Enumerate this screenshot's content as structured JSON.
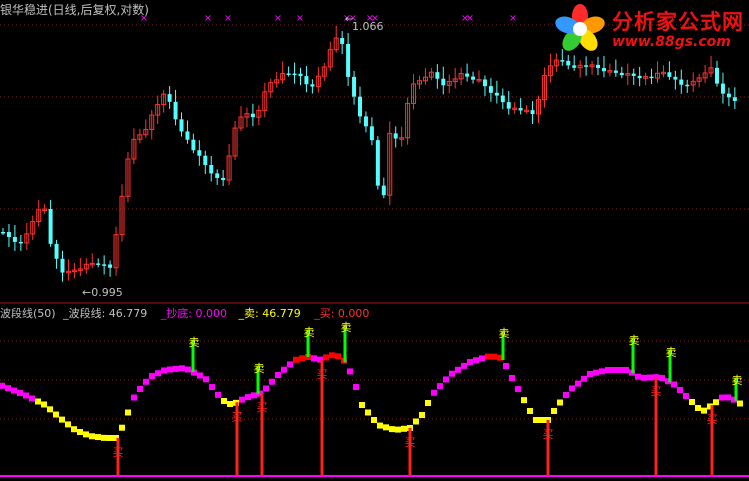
{
  "main_panel": {
    "title": "银华稳进(日线,后复权,对数)",
    "high_marker": "1.066",
    "low_marker": "←0.995"
  },
  "indicator_panel": {
    "legend": [
      {
        "label": "波段线(50)",
        "color": "#c0c0c0"
      },
      {
        "label": "_波段线: 46.779",
        "color": "#c0c0c0"
      },
      {
        "label": "_抄底: 0.000",
        "color": "#ff00ff"
      },
      {
        "label": "_卖: 46.779",
        "color": "#ffff00"
      },
      {
        "label": "_买: 0.000",
        "color": "#ff3030"
      }
    ],
    "sell_label": "卖",
    "buy_label": "买"
  },
  "watermark": {
    "text": "分析家公式网",
    "url": "www.88gs.com"
  },
  "colors": {
    "up_candle": "#ff3232",
    "down_candle": "#54ffff",
    "grid": "#8b1a1a",
    "wave_high": "#ff00ff",
    "wave_low": "#ffff00",
    "wave_peak": "#ff0000",
    "buy_line": "#ff2020",
    "sell_line": "#00ff00"
  }
}
